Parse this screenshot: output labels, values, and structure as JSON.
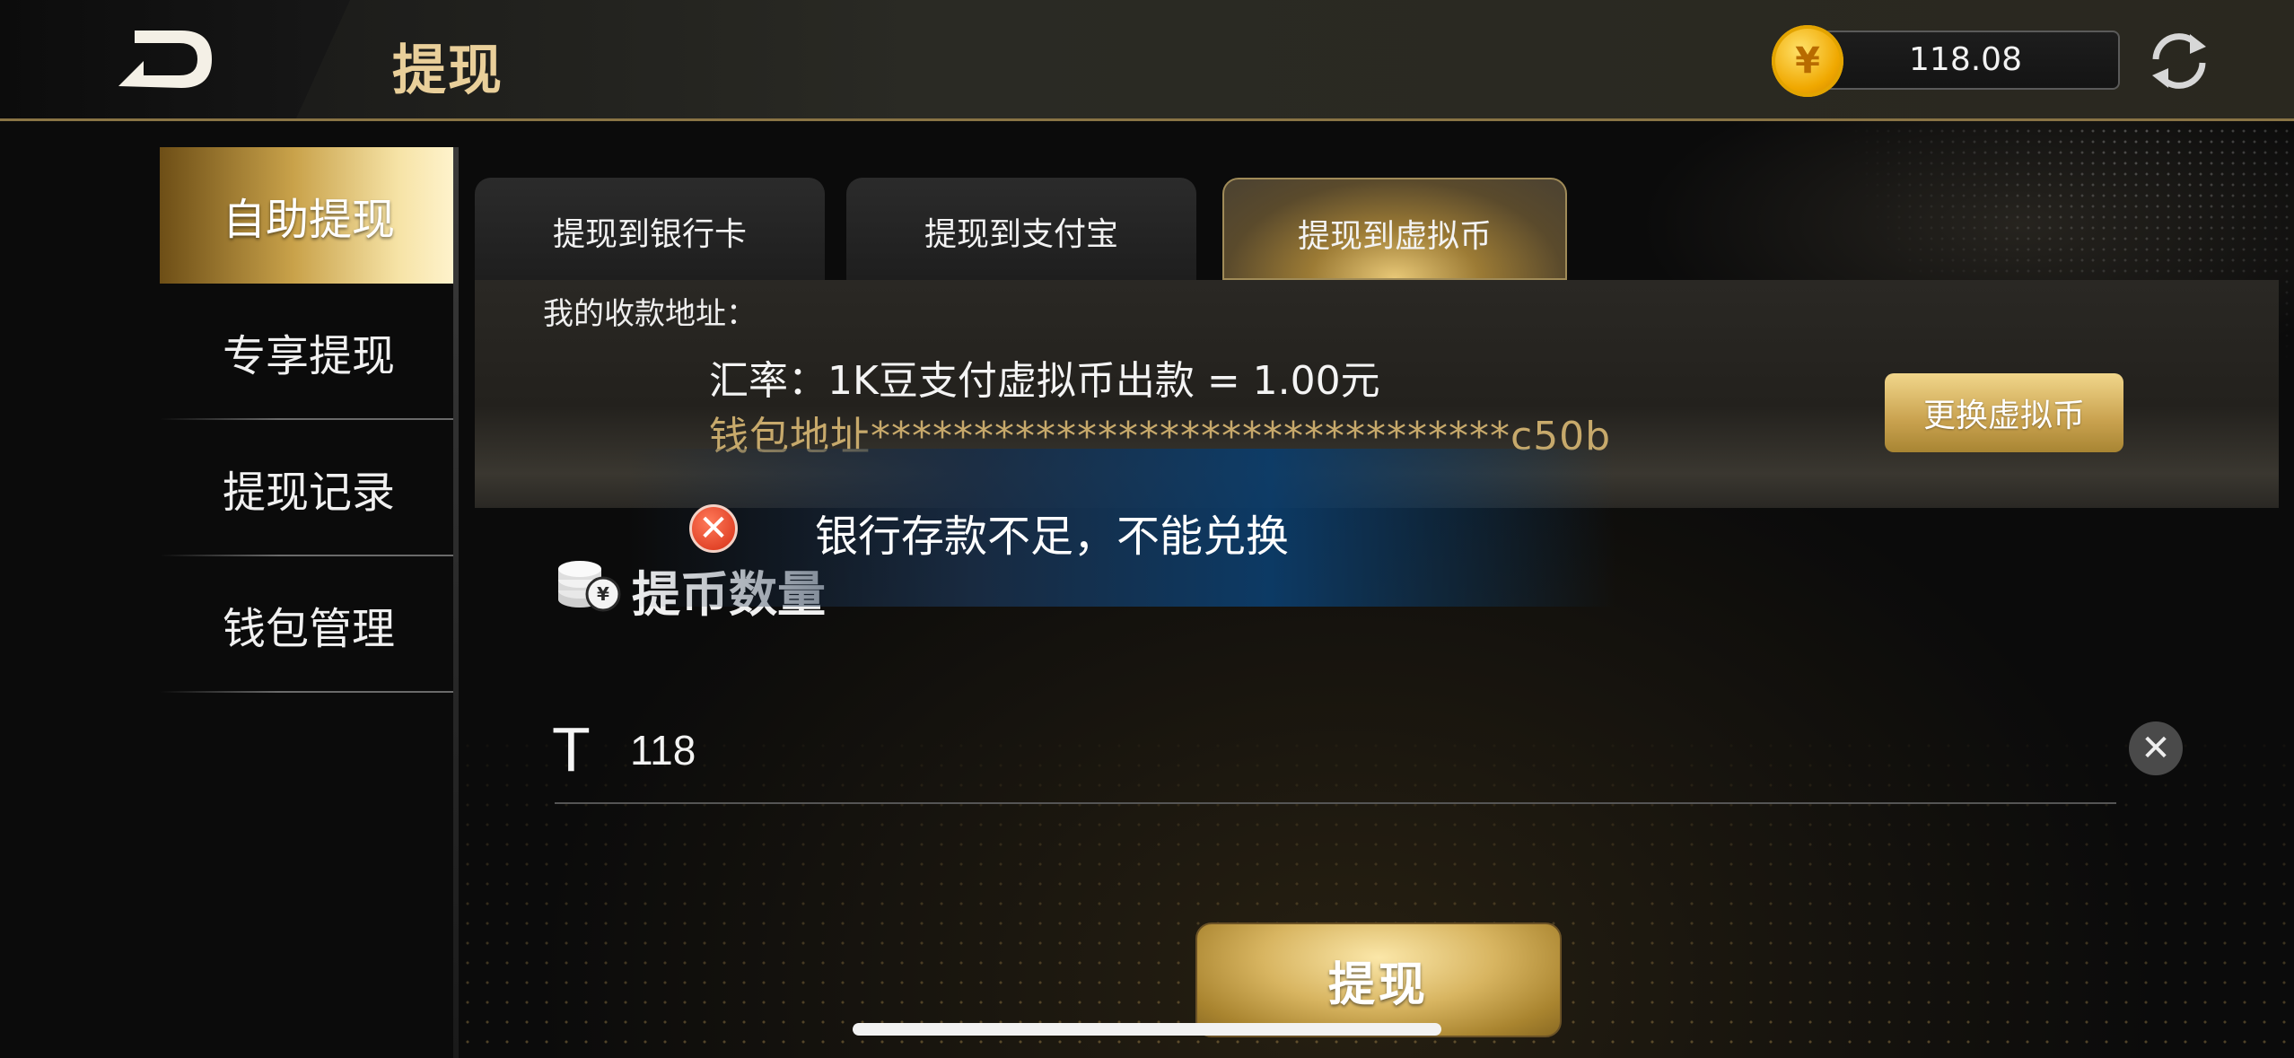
{
  "header": {
    "title": "提现",
    "balance": "118.08",
    "coin_symbol": "¥"
  },
  "sidebar": {
    "items": [
      {
        "label": "自助提现",
        "active": true
      },
      {
        "label": "专享提现",
        "active": false
      },
      {
        "label": "提现记录",
        "active": false
      },
      {
        "label": "钱包管理",
        "active": false
      }
    ]
  },
  "tabs": [
    {
      "label": "提现到银行卡",
      "active": false
    },
    {
      "label": "提现到支付宝",
      "active": false
    },
    {
      "label": "提现到虚拟币",
      "active": true
    }
  ],
  "info": {
    "address_label": "我的收款地址：",
    "rate": "汇率：1K豆支付虚拟币出款 = 1.00元",
    "wallet": "钱包地址*******************************c50b",
    "change_button": "更换虚拟币"
  },
  "amount": {
    "title": "提币数量",
    "prefix": "T",
    "value": "118",
    "clear_symbol": "✕"
  },
  "toast": {
    "message": "银行存款不足，不能兑换",
    "icon_symbol": "✕"
  },
  "submit_label": "提现",
  "colors": {
    "gold": "#c9a24f",
    "header_text": "#e9cf9a",
    "wallet_text": "#c7a96b",
    "error": "#d62f15"
  }
}
